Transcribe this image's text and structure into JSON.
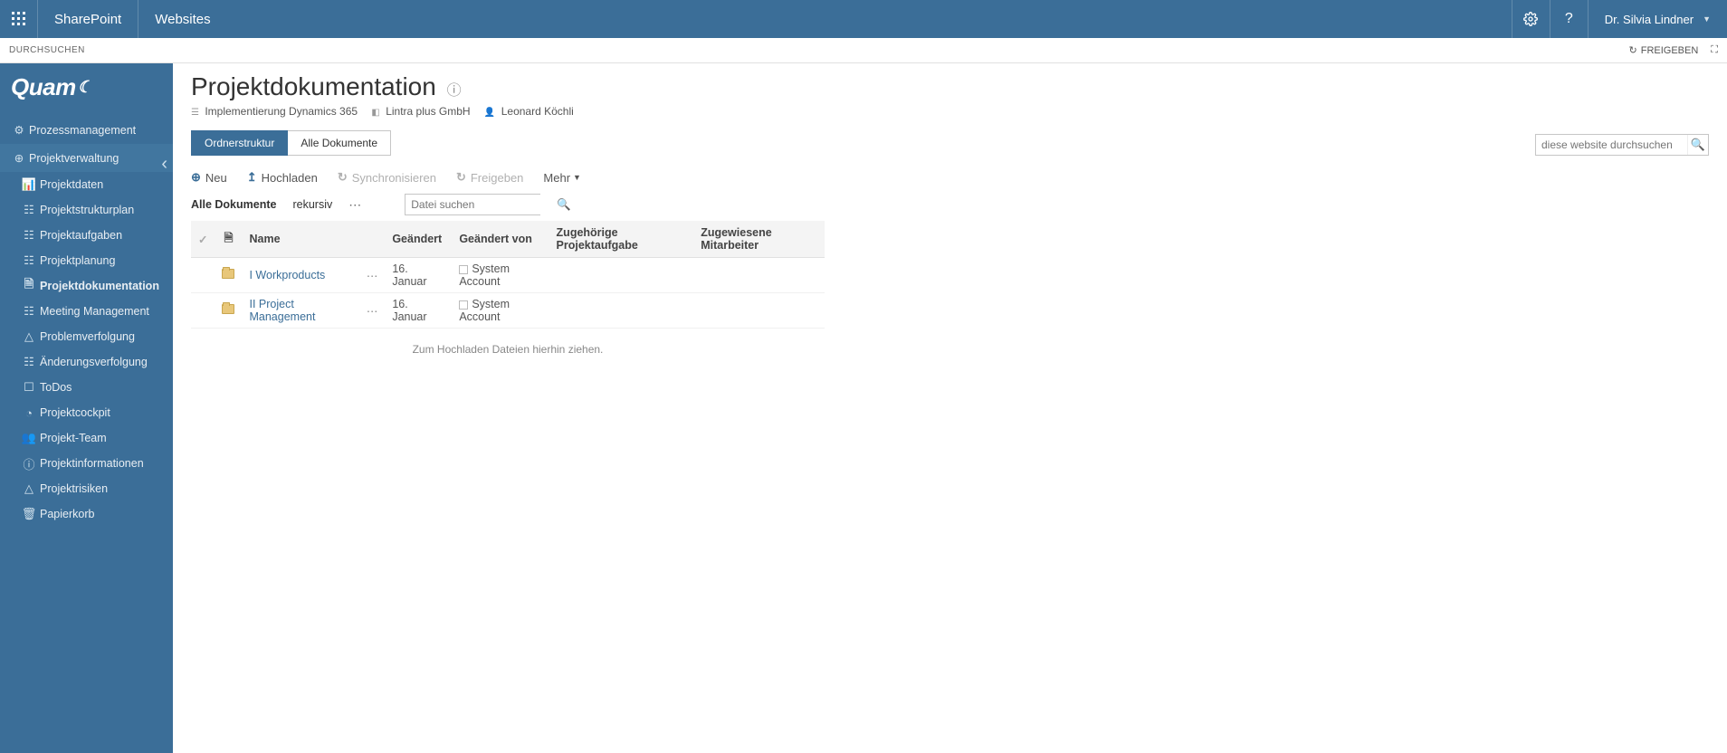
{
  "topbar": {
    "brand": "SharePoint",
    "sites": "Websites",
    "user": "Dr. Silvia Lindner"
  },
  "ribbon": {
    "tab": "DURCHSUCHEN",
    "share": "FREIGEBEN"
  },
  "sidebar": {
    "logo": "Quam",
    "groups": [
      {
        "label": "Prozessmanagement"
      },
      {
        "label": "Projektverwaltung"
      }
    ],
    "items": [
      {
        "label": "Projektdaten"
      },
      {
        "label": "Projektstrukturplan"
      },
      {
        "label": "Projektaufgaben"
      },
      {
        "label": "Projektplanung"
      },
      {
        "label": "Projektdokumentation"
      },
      {
        "label": "Meeting Management"
      },
      {
        "label": "Problemverfolgung"
      },
      {
        "label": "Änderungsverfolgung"
      },
      {
        "label": "ToDos"
      },
      {
        "label": "Projektcockpit"
      },
      {
        "label": "Projekt-Team"
      },
      {
        "label": "Projektinformationen"
      },
      {
        "label": "Projektrisiken"
      },
      {
        "label": "Papierkorb"
      }
    ]
  },
  "page": {
    "title": "Projektdokumentation",
    "bc1": "Implementierung Dynamics 365",
    "bc2": "Lintra plus GmbH",
    "bc3": "Leonard Köchli",
    "searchPlaceholder": "diese website durchsuchen"
  },
  "viewtabs": {
    "t1": "Ordnerstruktur",
    "t2": "Alle Dokumente"
  },
  "toolbar": {
    "neu": "Neu",
    "hochladen": "Hochladen",
    "sync": "Synchronisieren",
    "freigeben": "Freigeben",
    "mehr": "Mehr"
  },
  "filterbar": {
    "alle": "Alle Dokumente",
    "rekursiv": "rekursiv",
    "searchPlaceholder": "Datei suchen"
  },
  "table": {
    "cols": {
      "name": "Name",
      "geaendert": "Geändert",
      "geaendertVon": "Geändert von",
      "aufgabe": "Zugehörige Projektaufgabe",
      "mitarbeiter": "Zugewiesene Mitarbeiter"
    },
    "rows": [
      {
        "name": "I Workproducts",
        "geaendert": "16. Januar",
        "geaendertVon": "System Account"
      },
      {
        "name": "II Project Management",
        "geaendert": "16. Januar",
        "geaendertVon": "System Account"
      }
    ],
    "dropmsg": "Zum Hochladen Dateien hierhin ziehen."
  }
}
